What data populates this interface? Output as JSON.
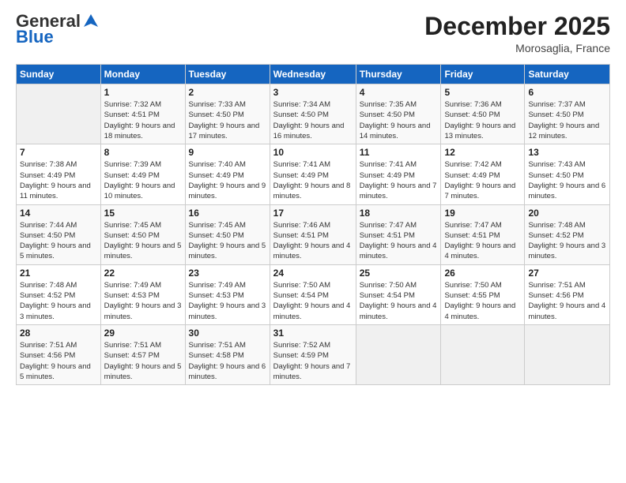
{
  "header": {
    "logo_general": "General",
    "logo_blue": "Blue",
    "month_year": "December 2025",
    "location": "Morosaglia, France"
  },
  "days_of_week": [
    "Sunday",
    "Monday",
    "Tuesday",
    "Wednesday",
    "Thursday",
    "Friday",
    "Saturday"
  ],
  "weeks": [
    [
      {
        "day": "",
        "info": ""
      },
      {
        "day": "1",
        "info": "Sunrise: 7:32 AM\nSunset: 4:51 PM\nDaylight: 9 hours\nand 18 minutes."
      },
      {
        "day": "2",
        "info": "Sunrise: 7:33 AM\nSunset: 4:50 PM\nDaylight: 9 hours\nand 17 minutes."
      },
      {
        "day": "3",
        "info": "Sunrise: 7:34 AM\nSunset: 4:50 PM\nDaylight: 9 hours\nand 16 minutes."
      },
      {
        "day": "4",
        "info": "Sunrise: 7:35 AM\nSunset: 4:50 PM\nDaylight: 9 hours\nand 14 minutes."
      },
      {
        "day": "5",
        "info": "Sunrise: 7:36 AM\nSunset: 4:50 PM\nDaylight: 9 hours\nand 13 minutes."
      },
      {
        "day": "6",
        "info": "Sunrise: 7:37 AM\nSunset: 4:50 PM\nDaylight: 9 hours\nand 12 minutes."
      }
    ],
    [
      {
        "day": "7",
        "info": "Sunrise: 7:38 AM\nSunset: 4:49 PM\nDaylight: 9 hours\nand 11 minutes."
      },
      {
        "day": "8",
        "info": "Sunrise: 7:39 AM\nSunset: 4:49 PM\nDaylight: 9 hours\nand 10 minutes."
      },
      {
        "day": "9",
        "info": "Sunrise: 7:40 AM\nSunset: 4:49 PM\nDaylight: 9 hours\nand 9 minutes."
      },
      {
        "day": "10",
        "info": "Sunrise: 7:41 AM\nSunset: 4:49 PM\nDaylight: 9 hours\nand 8 minutes."
      },
      {
        "day": "11",
        "info": "Sunrise: 7:41 AM\nSunset: 4:49 PM\nDaylight: 9 hours\nand 7 minutes."
      },
      {
        "day": "12",
        "info": "Sunrise: 7:42 AM\nSunset: 4:49 PM\nDaylight: 9 hours\nand 7 minutes."
      },
      {
        "day": "13",
        "info": "Sunrise: 7:43 AM\nSunset: 4:50 PM\nDaylight: 9 hours\nand 6 minutes."
      }
    ],
    [
      {
        "day": "14",
        "info": "Sunrise: 7:44 AM\nSunset: 4:50 PM\nDaylight: 9 hours\nand 5 minutes."
      },
      {
        "day": "15",
        "info": "Sunrise: 7:45 AM\nSunset: 4:50 PM\nDaylight: 9 hours\nand 5 minutes."
      },
      {
        "day": "16",
        "info": "Sunrise: 7:45 AM\nSunset: 4:50 PM\nDaylight: 9 hours\nand 5 minutes."
      },
      {
        "day": "17",
        "info": "Sunrise: 7:46 AM\nSunset: 4:51 PM\nDaylight: 9 hours\nand 4 minutes."
      },
      {
        "day": "18",
        "info": "Sunrise: 7:47 AM\nSunset: 4:51 PM\nDaylight: 9 hours\nand 4 minutes."
      },
      {
        "day": "19",
        "info": "Sunrise: 7:47 AM\nSunset: 4:51 PM\nDaylight: 9 hours\nand 4 minutes."
      },
      {
        "day": "20",
        "info": "Sunrise: 7:48 AM\nSunset: 4:52 PM\nDaylight: 9 hours\nand 3 minutes."
      }
    ],
    [
      {
        "day": "21",
        "info": "Sunrise: 7:48 AM\nSunset: 4:52 PM\nDaylight: 9 hours\nand 3 minutes."
      },
      {
        "day": "22",
        "info": "Sunrise: 7:49 AM\nSunset: 4:53 PM\nDaylight: 9 hours\nand 3 minutes."
      },
      {
        "day": "23",
        "info": "Sunrise: 7:49 AM\nSunset: 4:53 PM\nDaylight: 9 hours\nand 3 minutes."
      },
      {
        "day": "24",
        "info": "Sunrise: 7:50 AM\nSunset: 4:54 PM\nDaylight: 9 hours\nand 4 minutes."
      },
      {
        "day": "25",
        "info": "Sunrise: 7:50 AM\nSunset: 4:54 PM\nDaylight: 9 hours\nand 4 minutes."
      },
      {
        "day": "26",
        "info": "Sunrise: 7:50 AM\nSunset: 4:55 PM\nDaylight: 9 hours\nand 4 minutes."
      },
      {
        "day": "27",
        "info": "Sunrise: 7:51 AM\nSunset: 4:56 PM\nDaylight: 9 hours\nand 4 minutes."
      }
    ],
    [
      {
        "day": "28",
        "info": "Sunrise: 7:51 AM\nSunset: 4:56 PM\nDaylight: 9 hours\nand 5 minutes."
      },
      {
        "day": "29",
        "info": "Sunrise: 7:51 AM\nSunset: 4:57 PM\nDaylight: 9 hours\nand 5 minutes."
      },
      {
        "day": "30",
        "info": "Sunrise: 7:51 AM\nSunset: 4:58 PM\nDaylight: 9 hours\nand 6 minutes."
      },
      {
        "day": "31",
        "info": "Sunrise: 7:52 AM\nSunset: 4:59 PM\nDaylight: 9 hours\nand 7 minutes."
      },
      {
        "day": "",
        "info": ""
      },
      {
        "day": "",
        "info": ""
      },
      {
        "day": "",
        "info": ""
      }
    ]
  ]
}
